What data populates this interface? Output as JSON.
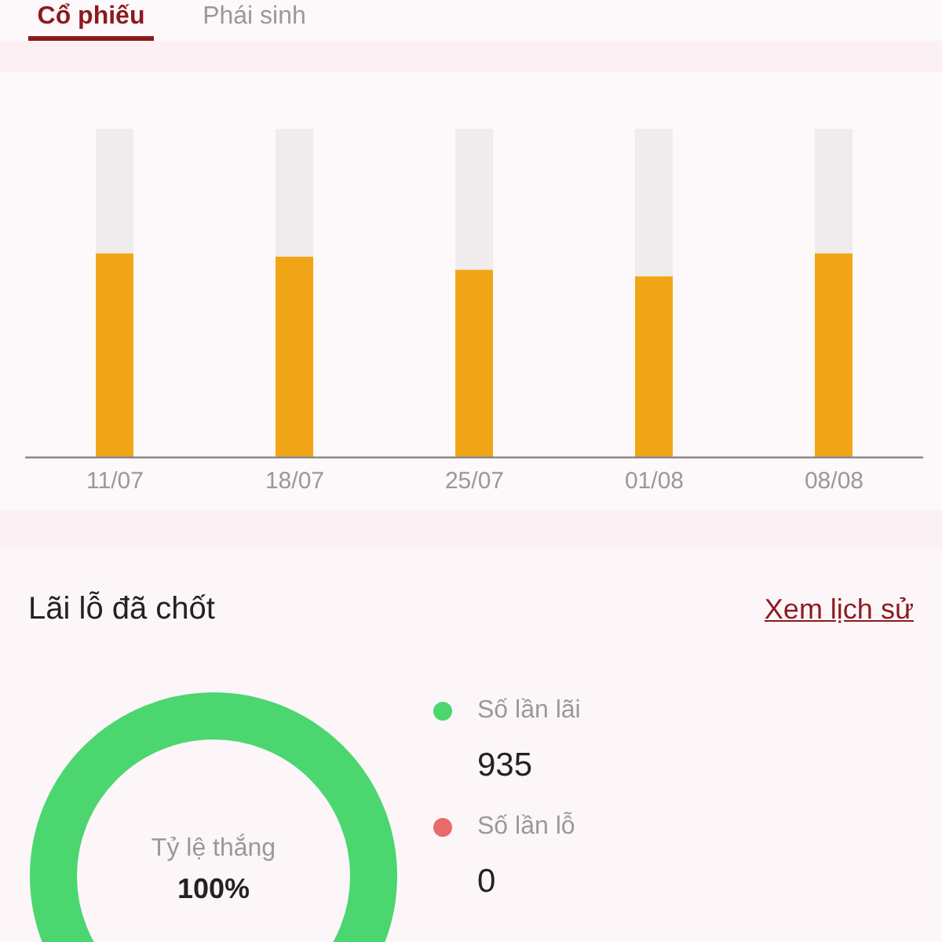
{
  "tabs": [
    {
      "label": "Cổ phiếu",
      "selected": true
    },
    {
      "label": "Phái sinh",
      "selected": false
    }
  ],
  "weekly_chart": {
    "x_labels": [
      "11/07",
      "18/07",
      "25/07",
      "01/08",
      "08/08"
    ]
  },
  "closed_pnl": {
    "title": "Lãi lỗ đã chốt",
    "history_link": "Xem lịch sử",
    "win_rate": {
      "label": "Tỷ lệ thắng",
      "value": "100%"
    },
    "legend": [
      {
        "label": "Số lần lãi",
        "value": "935",
        "color": "#4cd670"
      },
      {
        "label": "Số lần lỗ",
        "value": "0",
        "color": "#e96a6a"
      }
    ]
  }
}
